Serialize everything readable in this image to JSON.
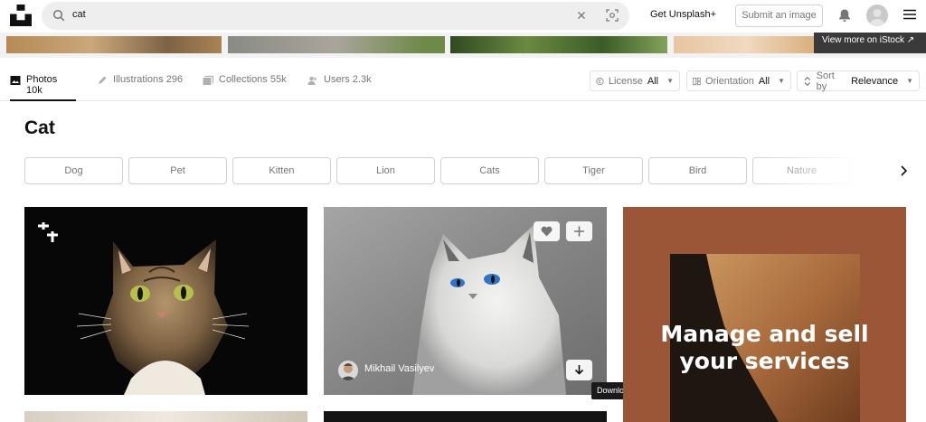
{
  "header": {
    "search_value": "cat",
    "get_plus": "Get Unsplash+",
    "submit": "Submit an image"
  },
  "strip": {
    "istock": "View more on iStock ↗"
  },
  "tabs": [
    {
      "label": "Photos",
      "count": "10k"
    },
    {
      "label": "Illustrations",
      "count": "296"
    },
    {
      "label": "Collections",
      "count": "55k"
    },
    {
      "label": "Users",
      "count": "2.3k"
    }
  ],
  "filters": {
    "license": {
      "label": "License",
      "value": "All"
    },
    "orientation": {
      "label": "Orientation",
      "value": "All"
    },
    "sort": {
      "label": "Sort by",
      "value": "Relevance"
    }
  },
  "page_title": "Cat",
  "related": [
    "Dog",
    "Pet",
    "Kitten",
    "Lion",
    "Cats",
    "Tiger",
    "Bird",
    "Nature"
  ],
  "photo2": {
    "photographer": "Mikhail Vasilyev",
    "tooltip": "Download this image"
  },
  "ad": {
    "line1": "Manage and sell",
    "line2": "your services"
  },
  "colors": {
    "ad_bg": "#9a5636",
    "tooltip_bg": "#1a1a1a"
  }
}
